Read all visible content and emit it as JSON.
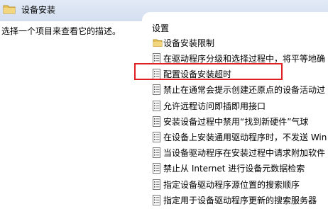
{
  "window": {
    "title": "设备安装"
  },
  "left_pane": {
    "description": "选择一个项目来查看它的描述。"
  },
  "right_pane": {
    "column_header": "设置",
    "folder_item": "设备安装限制",
    "settings": [
      "在驱动程序分级和选择过程中，将平等地确",
      "配置设备安装超时",
      "禁止在通常会提示创建还原点的设备活动过",
      "允许远程访问即插即用接口",
      "安装设备过程中禁用“找到新硬件”气球",
      "在设备上安装通用驱动程序时，不发送 Win",
      "当设备驱动程序在安装过程中请求附加软件",
      "禁止从 Internet 进行设备元数据检索",
      "指定设备驱动程序源位置的搜索顺序",
      "指定用于设备驱动程序更新的搜索服务器"
    ],
    "highlighted_index": 1
  },
  "colors": {
    "title_bar": "#d8e2f2",
    "highlight": "#e02020",
    "folder": "#e8c25a"
  },
  "icons": {
    "title": "folder-icon",
    "folder_item": "folder-icon",
    "setting": "policy-setting-icon"
  }
}
